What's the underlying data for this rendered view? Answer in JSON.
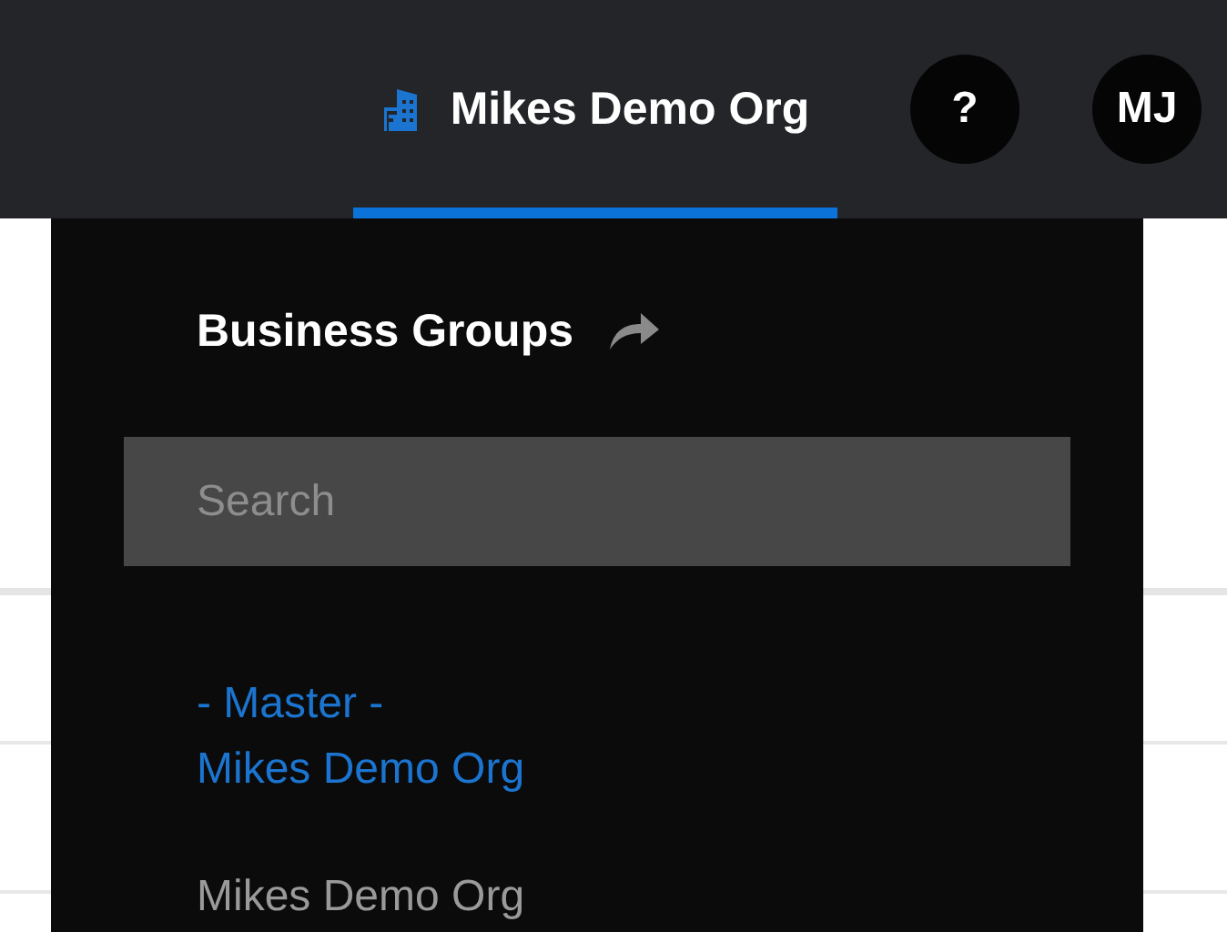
{
  "header": {
    "org_switcher": {
      "label": "Mikes Demo Org",
      "selected": true
    },
    "help": "?",
    "avatar": "MJ"
  },
  "business_groups": {
    "title": "Business Groups",
    "search": {
      "placeholder": "Search"
    },
    "items": [
      {
        "tag": "- Master -",
        "name": "Mikes Demo Org",
        "selected": true
      },
      {
        "name": "Mikes Demo Org",
        "selected": false
      }
    ]
  }
}
